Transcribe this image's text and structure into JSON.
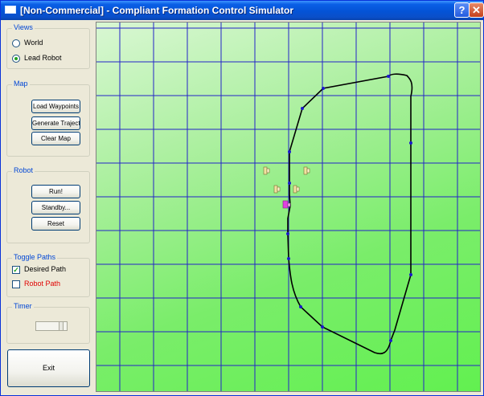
{
  "window": {
    "title": "[Non-Commercial] - Compliant Formation Control Simulator",
    "help_label": "?",
    "close_label": "✕"
  },
  "views": {
    "title": "Views",
    "options": [
      {
        "label": "World",
        "selected": false
      },
      {
        "label": "Lead Robot",
        "selected": true
      }
    ]
  },
  "map_group": {
    "title": "Map",
    "load_waypoints": "Load Waypoints",
    "generate_trajectory": "Generate Trajectory",
    "clear_map": "Clear Map"
  },
  "robot": {
    "title": "Robot",
    "run": "Run!",
    "standby": "Standby...",
    "reset": "Reset"
  },
  "toggle_paths": {
    "title": "Toggle Paths",
    "desired": {
      "label": "Desired Path",
      "checked": true,
      "color": "#000000"
    },
    "robot": {
      "label": "Robot Path",
      "checked": false,
      "color": "#e00000"
    }
  },
  "timer": {
    "title": "Timer"
  },
  "exit_label": "Exit",
  "colors": {
    "grid": "#2424c8",
    "path": "#000000",
    "waypoint": "#1a1acc",
    "lead_robot": "#e040e0",
    "follower_robot": "#f0e2a0"
  }
}
